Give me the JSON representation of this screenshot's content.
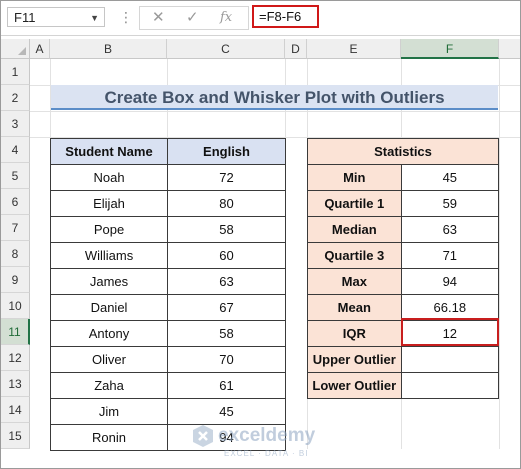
{
  "formula_bar": {
    "name_box": "F11",
    "cancel_icon": "✕",
    "enter_icon": "✓",
    "function_icon": "fx",
    "formula": "=F8-F6"
  },
  "columns": [
    "A",
    "B",
    "C",
    "D",
    "E",
    "F"
  ],
  "rows": [
    "1",
    "2",
    "3",
    "4",
    "5",
    "6",
    "7",
    "8",
    "9",
    "10",
    "11",
    "12",
    "13",
    "14",
    "15"
  ],
  "selected": {
    "column": "F",
    "row": "11"
  },
  "title": "Create Box and Whisker Plot with Outliers",
  "students": {
    "headers": [
      "Student Name",
      "English"
    ],
    "rows": [
      [
        "Noah",
        "72"
      ],
      [
        "Elijah",
        "80"
      ],
      [
        "Pope",
        "58"
      ],
      [
        "Williams",
        "60"
      ],
      [
        "James",
        "63"
      ],
      [
        "Daniel",
        "67"
      ],
      [
        "Antony",
        "58"
      ],
      [
        "Oliver",
        "70"
      ],
      [
        "Zaha",
        "61"
      ],
      [
        "Jim",
        "45"
      ],
      [
        "Ronin",
        "94"
      ]
    ]
  },
  "statistics": {
    "header": "Statistics",
    "rows": [
      [
        "Min",
        "45"
      ],
      [
        "Quartile 1",
        "59"
      ],
      [
        "Median",
        "63"
      ],
      [
        "Quartile 3",
        "71"
      ],
      [
        "Max",
        "94"
      ],
      [
        "Mean",
        "66.18"
      ],
      [
        "IQR",
        "12"
      ],
      [
        "Upper Outlier",
        ""
      ],
      [
        "Lower Outlier",
        ""
      ]
    ]
  },
  "watermark": {
    "name": "exceldemy",
    "tagline": "EXCEL · DATA · BI"
  }
}
